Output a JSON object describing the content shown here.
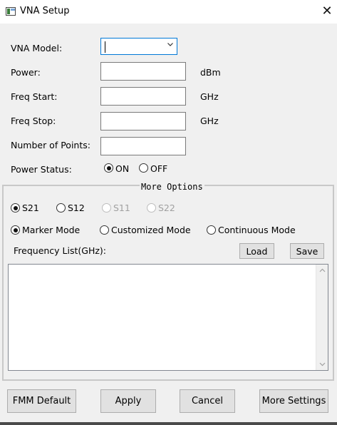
{
  "window": {
    "title": "VNA Setup"
  },
  "form": {
    "vna_model_label": "VNA Model:",
    "vna_model_value": "",
    "power_label": "Power:",
    "power_value": "",
    "power_unit": "dBm",
    "freq_start_label": "Freq Start:",
    "freq_start_value": "",
    "freq_start_unit": "GHz",
    "freq_stop_label": "Freq Stop:",
    "freq_stop_value": "",
    "freq_stop_unit": "GHz",
    "points_label": "Number of Points:",
    "points_value": "",
    "power_status_label": "Power Status:",
    "power_status_options": [
      {
        "label": "ON",
        "checked": true
      },
      {
        "label": "OFF",
        "checked": false
      }
    ]
  },
  "more_options": {
    "title": "More Options",
    "sparams": [
      {
        "label": "S21",
        "checked": true,
        "enabled": true
      },
      {
        "label": "S12",
        "checked": false,
        "enabled": true
      },
      {
        "label": "S11",
        "checked": false,
        "enabled": false
      },
      {
        "label": "S22",
        "checked": false,
        "enabled": false
      }
    ],
    "modes": [
      {
        "label": "Marker Mode",
        "checked": true
      },
      {
        "label": "Customized Mode",
        "checked": false
      },
      {
        "label": "Continuous Mode",
        "checked": false
      }
    ],
    "freq_list_label": "Frequency List(GHz):",
    "load_label": "Load",
    "save_label": "Save",
    "freq_list_value": ""
  },
  "footer": {
    "fmm_default_label": "FMM Default",
    "apply_label": "Apply",
    "cancel_label": "Cancel",
    "more_settings_label": "More Settings"
  },
  "colors": {
    "window_bg": "#f0f0f0",
    "focus_border": "#0078d7",
    "button_bg": "#e1e1e1",
    "disabled_text": "#a0a0a0"
  }
}
